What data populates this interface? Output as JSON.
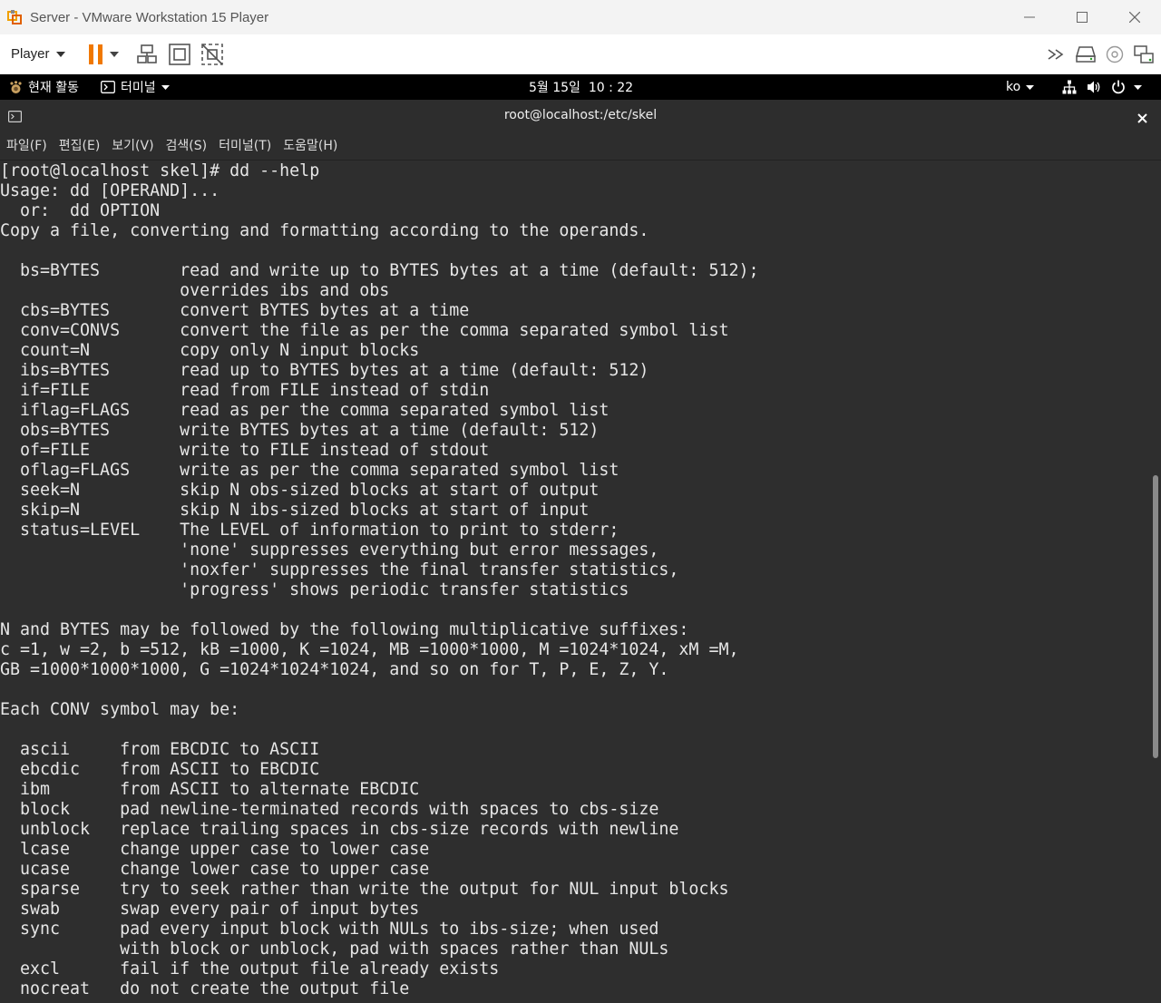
{
  "window": {
    "title": "Server - VMware Workstation 15 Player"
  },
  "toolbar": {
    "player_label": "Player"
  },
  "gnome": {
    "activities": "현재 활동",
    "app_menu": "터미널",
    "clock": "5월 15일  10 : 22",
    "input_method": "ko"
  },
  "terminal": {
    "title": "root@localhost:/etc/skel",
    "menu": [
      "파일(F)",
      "편집(E)",
      "보기(V)",
      "검색(S)",
      "터미널(T)",
      "도움말(H)"
    ],
    "lines": [
      "[root@localhost skel]# dd --help",
      "Usage: dd [OPERAND]...",
      "  or:  dd OPTION",
      "Copy a file, converting and formatting according to the operands.",
      "",
      "  bs=BYTES        read and write up to BYTES bytes at a time (default: 512);",
      "                  overrides ibs and obs",
      "  cbs=BYTES       convert BYTES bytes at a time",
      "  conv=CONVS      convert the file as per the comma separated symbol list",
      "  count=N         copy only N input blocks",
      "  ibs=BYTES       read up to BYTES bytes at a time (default: 512)",
      "  if=FILE         read from FILE instead of stdin",
      "  iflag=FLAGS     read as per the comma separated symbol list",
      "  obs=BYTES       write BYTES bytes at a time (default: 512)",
      "  of=FILE         write to FILE instead of stdout",
      "  oflag=FLAGS     write as per the comma separated symbol list",
      "  seek=N          skip N obs-sized blocks at start of output",
      "  skip=N          skip N ibs-sized blocks at start of input",
      "  status=LEVEL    The LEVEL of information to print to stderr;",
      "                  'none' suppresses everything but error messages,",
      "                  'noxfer' suppresses the final transfer statistics,",
      "                  'progress' shows periodic transfer statistics",
      "",
      "N and BYTES may be followed by the following multiplicative suffixes:",
      "c =1, w =2, b =512, kB =1000, K =1024, MB =1000*1000, M =1024*1024, xM =M,",
      "GB =1000*1000*1000, G =1024*1024*1024, and so on for T, P, E, Z, Y.",
      "",
      "Each CONV symbol may be:",
      "",
      "  ascii     from EBCDIC to ASCII",
      "  ebcdic    from ASCII to EBCDIC",
      "  ibm       from ASCII to alternate EBCDIC",
      "  block     pad newline-terminated records with spaces to cbs-size",
      "  unblock   replace trailing spaces in cbs-size records with newline",
      "  lcase     change upper case to lower case",
      "  ucase     change lower case to upper case",
      "  sparse    try to seek rather than write the output for NUL input blocks",
      "  swab      swap every pair of input bytes",
      "  sync      pad every input block with NULs to ibs-size; when used",
      "            with block or unblock, pad with spaces rather than NULs",
      "  excl      fail if the output file already exists",
      "  nocreat   do not create the output file"
    ]
  },
  "colors": {
    "terminal_bg": "#2e2e2e",
    "terminal_fg": "#e6e6e6",
    "pause_orange": "#f07800",
    "gnome_bar": "#000000"
  }
}
